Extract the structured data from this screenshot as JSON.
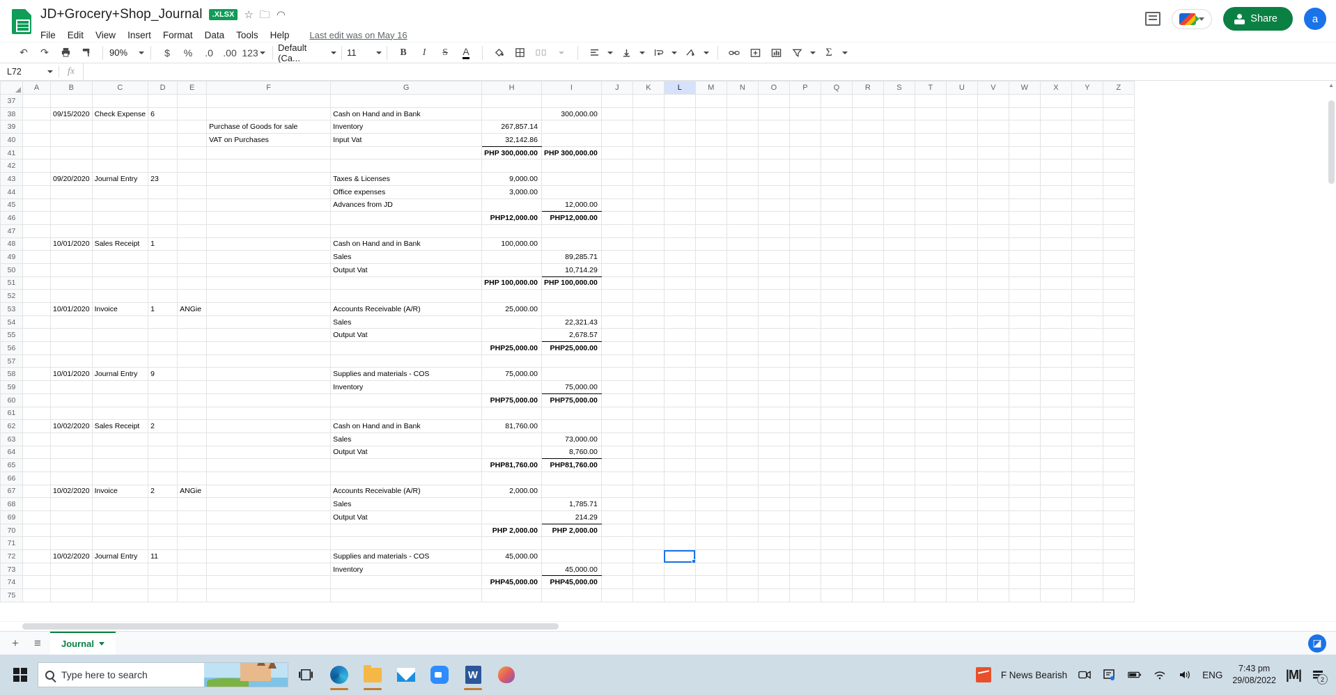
{
  "titlebar": {
    "doc_title": "JD+Grocery+Shop_Journal",
    "file_badge": ".XLSX",
    "star_icon": "star-icon",
    "move_icon": "move-to-folder-icon",
    "cloud_icon": "cloud-saved-icon",
    "menus": [
      "File",
      "Edit",
      "View",
      "Insert",
      "Format",
      "Data",
      "Tools",
      "Help"
    ],
    "last_edit": "Last edit was on May 16",
    "share_label": "Share",
    "avatar_initial": "a",
    "accent_green": "#0b8043",
    "accent_blue": "#1a73e8"
  },
  "toolbar": {
    "undo": "↶",
    "redo": "↷",
    "print": "🖶",
    "paint_format": "paint-format-icon",
    "zoom_value": "90%",
    "currency": "$",
    "percent": "%",
    "dec_decrease": ".0",
    "dec_increase": ".00",
    "more_formats": "123",
    "font_family": "Default (Ca...",
    "font_size": "11",
    "bold": "B",
    "italic": "I",
    "strikethrough": "S",
    "text_color": "A",
    "fill_color": "fill-color-icon",
    "borders": "borders-icon",
    "merge": "merge-cells-icon",
    "halign": "horizontal-align-icon",
    "valign": "vertical-align-icon",
    "text_wrap": "text-wrapping-icon",
    "text_rotate": "text-rotation-icon",
    "insert_link": "link-icon",
    "insert_comment": "insert-comment-icon",
    "insert_chart": "insert-chart-icon",
    "filter": "filter-icon",
    "functions": "functions-icon"
  },
  "formula_bar": {
    "name_box": "L72",
    "fx_label": "fx",
    "formula_value": ""
  },
  "grid": {
    "columns": [
      "A",
      "B",
      "C",
      "D",
      "E",
      "F",
      "G",
      "H",
      "I",
      "J",
      "K",
      "L",
      "M",
      "N",
      "O",
      "P",
      "Q",
      "R",
      "S",
      "T",
      "U",
      "V",
      "W",
      "X",
      "Y",
      "Z"
    ],
    "selected_column": "L",
    "selected_cell": "L72",
    "rows": [
      {
        "n": "37",
        "B": "",
        "C": "",
        "D": "",
        "E": "",
        "F": "",
        "G": "",
        "H": "",
        "I": ""
      },
      {
        "n": "38",
        "B": "09/15/2020",
        "C": "Check Expense",
        "D": "6",
        "E": "",
        "F": "",
        "G": "Cash on Hand and in Bank",
        "H": "",
        "I": "300,000.00"
      },
      {
        "n": "39",
        "B": "",
        "C": "",
        "D": "",
        "E": "",
        "F": "Purchase of Goods for sale",
        "G": "Inventory",
        "H": "267,857.14",
        "I": ""
      },
      {
        "n": "40",
        "B": "",
        "C": "",
        "D": "",
        "E": "",
        "F": "VAT on Purchases",
        "G": "Input Vat",
        "H": "32,142.86",
        "I": "",
        "H_underline": true
      },
      {
        "n": "41",
        "B": "",
        "C": "",
        "D": "",
        "E": "",
        "F": "",
        "G": "",
        "H": "PHP 300,000.00",
        "I": "PHP 300,000.00",
        "bold": true,
        "topline": true
      },
      {
        "n": "42",
        "B": "",
        "C": "",
        "D": "",
        "E": "",
        "F": "",
        "G": "",
        "H": "",
        "I": ""
      },
      {
        "n": "43",
        "B": "09/20/2020",
        "C": "Journal Entry",
        "D": "23",
        "E": "",
        "F": "",
        "G": "Taxes & Licenses",
        "H": "9,000.00",
        "I": ""
      },
      {
        "n": "44",
        "B": "",
        "C": "",
        "D": "",
        "E": "",
        "F": "",
        "G": "Office expenses",
        "H": "3,000.00",
        "I": ""
      },
      {
        "n": "45",
        "B": "",
        "C": "",
        "D": "",
        "E": "",
        "F": "",
        "G": "Advances from JD",
        "H": "",
        "I": "12,000.00",
        "underline": true
      },
      {
        "n": "46",
        "B": "",
        "C": "",
        "D": "",
        "E": "",
        "F": "",
        "G": "",
        "H": "PHP12,000.00",
        "I": "PHP12,000.00",
        "bold": true,
        "topline": true
      },
      {
        "n": "47",
        "B": "",
        "C": "",
        "D": "",
        "E": "",
        "F": "",
        "G": "",
        "H": "",
        "I": ""
      },
      {
        "n": "48",
        "B": "10/01/2020",
        "C": "Sales Receipt",
        "D": "1",
        "E": "",
        "F": "",
        "G": "Cash on Hand and in Bank",
        "H": "100,000.00",
        "I": ""
      },
      {
        "n": "49",
        "B": "",
        "C": "",
        "D": "",
        "E": "",
        "F": "",
        "G": "Sales",
        "H": "",
        "I": "89,285.71"
      },
      {
        "n": "50",
        "B": "",
        "C": "",
        "D": "",
        "E": "",
        "F": "",
        "G": "Output Vat",
        "H": "",
        "I": "10,714.29",
        "underline": true
      },
      {
        "n": "51",
        "B": "",
        "C": "",
        "D": "",
        "E": "",
        "F": "",
        "G": "",
        "H": "PHP 100,000.00",
        "I": "PHP 100,000.00",
        "bold": true,
        "topline": true
      },
      {
        "n": "52",
        "B": "",
        "C": "",
        "D": "",
        "E": "",
        "F": "",
        "G": "",
        "H": "",
        "I": ""
      },
      {
        "n": "53",
        "B": "10/01/2020",
        "C": "Invoice",
        "D": "1",
        "E": "ANGie",
        "F": "",
        "G": "Accounts Receivable (A/R)",
        "H": "25,000.00",
        "I": ""
      },
      {
        "n": "54",
        "B": "",
        "C": "",
        "D": "",
        "E": "",
        "F": "",
        "G": "Sales",
        "H": "",
        "I": "22,321.43"
      },
      {
        "n": "55",
        "B": "",
        "C": "",
        "D": "",
        "E": "",
        "F": "",
        "G": "Output Vat",
        "H": "",
        "I": "2,678.57",
        "underline": true
      },
      {
        "n": "56",
        "B": "",
        "C": "",
        "D": "",
        "E": "",
        "F": "",
        "G": "",
        "H": "PHP25,000.00",
        "I": "PHP25,000.00",
        "bold": true,
        "topline": true
      },
      {
        "n": "57",
        "B": "",
        "C": "",
        "D": "",
        "E": "",
        "F": "",
        "G": "",
        "H": "",
        "I": ""
      },
      {
        "n": "58",
        "B": "10/01/2020",
        "C": "Journal Entry",
        "D": "9",
        "E": "",
        "F": "",
        "G": "Supplies and materials - COS",
        "H": "75,000.00",
        "I": ""
      },
      {
        "n": "59",
        "B": "",
        "C": "",
        "D": "",
        "E": "",
        "F": "",
        "G": "Inventory",
        "H": "",
        "I": "75,000.00",
        "underline": true
      },
      {
        "n": "60",
        "B": "",
        "C": "",
        "D": "",
        "E": "",
        "F": "",
        "G": "",
        "H": "PHP75,000.00",
        "I": "PHP75,000.00",
        "bold": true,
        "topline": true
      },
      {
        "n": "61",
        "B": "",
        "C": "",
        "D": "",
        "E": "",
        "F": "",
        "G": "",
        "H": "",
        "I": ""
      },
      {
        "n": "62",
        "B": "10/02/2020",
        "C": "Sales Receipt",
        "D": "2",
        "E": "",
        "F": "",
        "G": "Cash on Hand and in Bank",
        "H": "81,760.00",
        "I": ""
      },
      {
        "n": "63",
        "B": "",
        "C": "",
        "D": "",
        "E": "",
        "F": "",
        "G": "Sales",
        "H": "",
        "I": "73,000.00"
      },
      {
        "n": "64",
        "B": "",
        "C": "",
        "D": "",
        "E": "",
        "F": "",
        "G": "Output Vat",
        "H": "",
        "I": "8,760.00",
        "underline": true
      },
      {
        "n": "65",
        "B": "",
        "C": "",
        "D": "",
        "E": "",
        "F": "",
        "G": "",
        "H": "PHP81,760.00",
        "I": "PHP81,760.00",
        "bold": true,
        "topline": true
      },
      {
        "n": "66",
        "B": "",
        "C": "",
        "D": "",
        "E": "",
        "F": "",
        "G": "",
        "H": "",
        "I": ""
      },
      {
        "n": "67",
        "B": "10/02/2020",
        "C": "Invoice",
        "D": "2",
        "E": "ANGie",
        "F": "",
        "G": "Accounts Receivable (A/R)",
        "H": "2,000.00",
        "I": ""
      },
      {
        "n": "68",
        "B": "",
        "C": "",
        "D": "",
        "E": "",
        "F": "",
        "G": "Sales",
        "H": "",
        "I": "1,785.71"
      },
      {
        "n": "69",
        "B": "",
        "C": "",
        "D": "",
        "E": "",
        "F": "",
        "G": "Output Vat",
        "H": "",
        "I": "214.29",
        "underline": true
      },
      {
        "n": "70",
        "B": "",
        "C": "",
        "D": "",
        "E": "",
        "F": "",
        "G": "",
        "H": "PHP  2,000.00",
        "I": "PHP  2,000.00",
        "bold": true,
        "topline": true
      },
      {
        "n": "71",
        "B": "",
        "C": "",
        "D": "",
        "E": "",
        "F": "",
        "G": "",
        "H": "",
        "I": ""
      },
      {
        "n": "72",
        "B": "10/02/2020",
        "C": "Journal Entry",
        "D": "11",
        "E": "",
        "F": "",
        "G": "Supplies and materials - COS",
        "H": "45,000.00",
        "I": "",
        "selected": true
      },
      {
        "n": "73",
        "B": "",
        "C": "",
        "D": "",
        "E": "",
        "F": "",
        "G": "Inventory",
        "H": "",
        "I": "45,000.00",
        "underline": true
      },
      {
        "n": "74",
        "B": "",
        "C": "",
        "D": "",
        "E": "",
        "F": "",
        "G": "",
        "H": "PHP45,000.00",
        "I": "PHP45,000.00",
        "bold": true,
        "topline": true
      },
      {
        "n": "75",
        "B": "",
        "C": "",
        "D": "",
        "E": "",
        "F": "",
        "G": "",
        "H": "",
        "I": ""
      }
    ]
  },
  "sheetbar": {
    "add_sheet": "+",
    "all_sheets": "≡",
    "tab_name": "Journal",
    "explore_icon": "explore-icon"
  },
  "taskbar": {
    "search_placeholder": "Type here to search",
    "task_view": "task-view-icon",
    "apps": [
      "edge-icon",
      "file-explorer-icon",
      "mail-icon",
      "zoom-icon",
      "word-icon",
      "paint-icon"
    ],
    "news_label": "F  News Bearish",
    "language": "ENG",
    "time": "7:43 pm",
    "date": "29/08/2022",
    "notification_count": "2"
  }
}
